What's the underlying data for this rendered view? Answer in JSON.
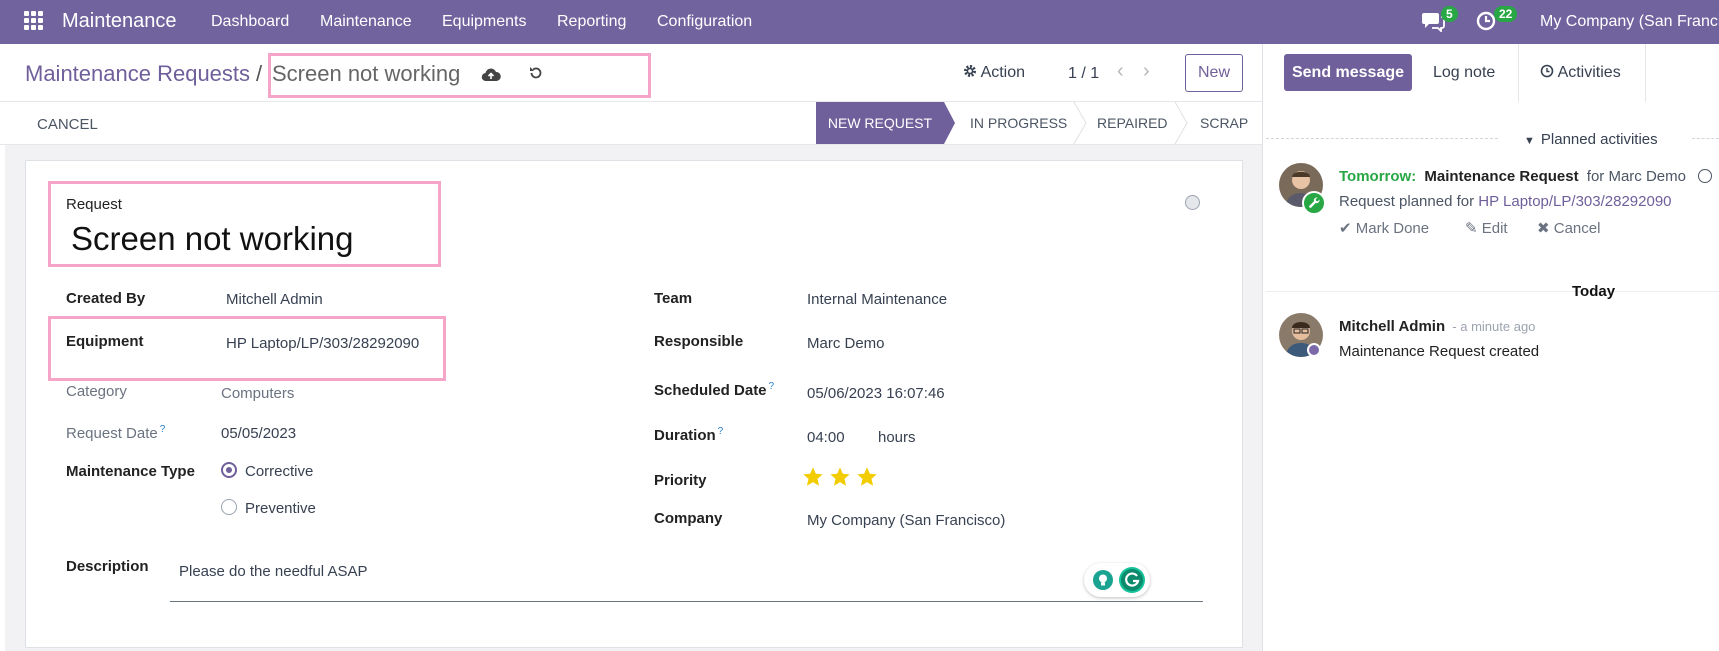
{
  "navbar": {
    "app_name": "Maintenance",
    "menu": [
      "Dashboard",
      "Maintenance",
      "Equipments",
      "Reporting",
      "Configuration"
    ],
    "messages_count": "5",
    "activities_count": "22",
    "company": "My Company (San Francisco)",
    "bg_color": "#71639e"
  },
  "breadcrumb": {
    "parent": "Maintenance Requests",
    "separator": "/",
    "current": "Screen not working"
  },
  "control": {
    "action": "Action",
    "pager": "1 / 1",
    "new": "New"
  },
  "status": {
    "cancel": "CANCEL",
    "stages": [
      "NEW REQUEST",
      "IN PROGRESS",
      "REPAIRED",
      "SCRAP"
    ],
    "active_stage": "NEW REQUEST"
  },
  "form": {
    "request_label": "Request",
    "request_value": "Screen not working",
    "left": {
      "created_by_label": "Created By",
      "created_by": "Mitchell Admin",
      "equipment_label": "Equipment",
      "equipment": "HP Laptop/LP/303/28292090",
      "category_label": "Category",
      "category": "Computers",
      "request_date_label": "Request Date",
      "request_date": "05/05/2023",
      "maintenance_type_label": "Maintenance Type",
      "type_options": [
        "Corrective",
        "Preventive"
      ],
      "selected_type": "Corrective"
    },
    "right": {
      "team_label": "Team",
      "team": "Internal Maintenance",
      "responsible_label": "Responsible",
      "responsible": "Marc Demo",
      "scheduled_label": "Scheduled Date",
      "scheduled": "05/06/2023 16:07:46",
      "duration_label": "Duration",
      "duration": "04:00",
      "duration_unit": "hours",
      "priority_label": "Priority",
      "priority_stars": 3,
      "company_label": "Company",
      "company": "My Company (San Francisco)"
    },
    "help_mark": "?",
    "description_label": "Description",
    "description": "Please do the needful ASAP"
  },
  "chatter": {
    "send_message": "Send message",
    "log_note": "Log note",
    "activities": "Activities",
    "planned_activities": "Planned activities",
    "activity": {
      "when": "Tomorrow:",
      "title": "Maintenance Request",
      "for": "for Marc Demo",
      "summary_prefix": "Request planned for",
      "summary_link": "HP Laptop/LP/303/28292090",
      "mark_done": "Mark Done",
      "edit": "Edit",
      "cancel": "Cancel"
    },
    "today": "Today",
    "message": {
      "author": "Mitchell Admin",
      "time": "- a minute ago",
      "body": "Maintenance Request created"
    }
  },
  "colors": {
    "primary": "#6f5f9a",
    "success": "#28a745",
    "highlight": "#f5a6c8",
    "star": "#f3cc00"
  }
}
